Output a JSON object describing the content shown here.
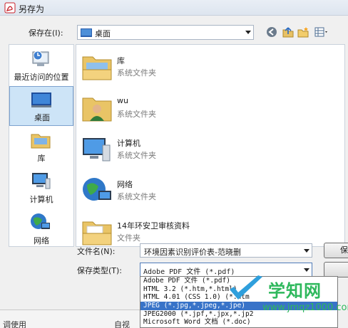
{
  "window": {
    "title": "另存为"
  },
  "location": {
    "label": "保存在(I):",
    "value": "桌面"
  },
  "places": [
    {
      "label": "最近访问的位置",
      "icon": "recent-places-icon"
    },
    {
      "label": "桌面",
      "icon": "desktop-icon",
      "selected": true
    },
    {
      "label": "库",
      "icon": "library-icon"
    },
    {
      "label": "计算机",
      "icon": "computer-icon"
    },
    {
      "label": "网络",
      "icon": "network-icon"
    }
  ],
  "files": [
    {
      "name": "库",
      "type": "系统文件夹",
      "icon": "library-folder-icon"
    },
    {
      "name": "wu",
      "type": "系统文件夹",
      "icon": "user-folder-icon"
    },
    {
      "name": "计算机",
      "type": "系统文件夹",
      "icon": "computer-icon"
    },
    {
      "name": "网络",
      "type": "系统文件夹",
      "icon": "network-icon"
    },
    {
      "name": "14年环安卫审核资料",
      "type": "文件夹",
      "icon": "folder-icon"
    }
  ],
  "form": {
    "filename_label": "文件名(N):",
    "filename_value": "环境因素识别评价表-范晓删",
    "filetype_label": "保存类型(T):",
    "filetype_value": "Adobe PDF 文件 (*.pdf)",
    "filetype_options": [
      "Adobe PDF 文件 (*.pdf)",
      "HTML 3.2 (*.htm,*.html)",
      "HTML 4.01 (CSS 1.0) (*.htm",
      "JPEG (*.jpg,*.jpeg,*.jpe)",
      "JPEG2000 (*.jpf,*.jpx,*.jp2",
      "Microsoft Word 文档 (*.doc)"
    ],
    "highlighted_option_index": 3
  },
  "buttons": {
    "save_label": "保"
  },
  "bottom_strip": {
    "left_text": "调使用",
    "right_text": "自视"
  },
  "watermark": {
    "title": "学知网",
    "url": "www.jmqz1000.com"
  },
  "colors": {
    "selection": "#3873c8",
    "watermark": "#2eb85c",
    "place_selected": "#cde4f7"
  }
}
